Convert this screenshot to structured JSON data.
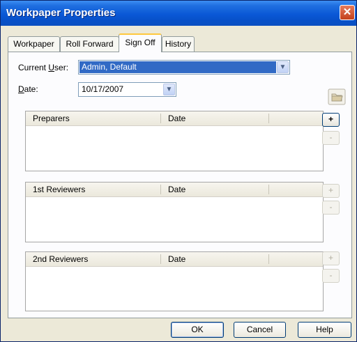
{
  "window": {
    "title": "Workpaper Properties",
    "close_glyph": "✕"
  },
  "tabs": [
    {
      "label": "Workpaper"
    },
    {
      "label": "Roll Forward"
    },
    {
      "label": "Sign Off"
    },
    {
      "label": "History"
    }
  ],
  "active_tab": "Sign Off",
  "current_user": {
    "label_pre": "Current ",
    "label_key": "U",
    "label_post": "ser:",
    "value": "Admin, Default"
  },
  "date_field": {
    "label_key": "D",
    "label_post": "ate:",
    "value": "10/17/2007"
  },
  "dropdown_glyph": "▼",
  "sections": [
    {
      "name_header": "Preparers",
      "date_header": "Date",
      "add_label": "+",
      "remove_label": "-"
    },
    {
      "name_header": "1st Reviewers",
      "date_header": "Date",
      "add_label": "+",
      "remove_label": "-"
    },
    {
      "name_header": "2nd Reviewers",
      "date_header": "Date",
      "add_label": "+",
      "remove_label": "-"
    }
  ],
  "buttons": {
    "ok": "OK",
    "cancel": "Cancel",
    "help": "Help"
  }
}
